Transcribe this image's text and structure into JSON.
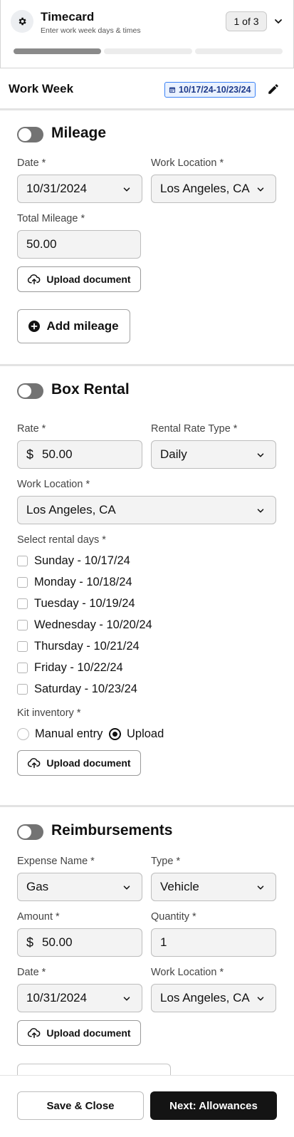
{
  "header": {
    "title": "Timecard",
    "subtitle": "Enter work week days & times",
    "pager": "1 of 3",
    "progress_steps": [
      "done",
      "pending",
      "pending"
    ]
  },
  "work_week": {
    "label": "Work Week",
    "range": "10/17/24-10/23/24"
  },
  "mileage": {
    "title": "Mileage",
    "enabled": false,
    "date_label": "Date *",
    "date_value": "10/31/2024",
    "location_label": "Work Location *",
    "location_value": "Los Angeles, CA",
    "total_label": "Total Mileage *",
    "total_value": "50.00",
    "upload_label": "Upload document",
    "add_label": "Add mileage"
  },
  "box_rental": {
    "title": "Box Rental",
    "enabled": false,
    "rate_label": "Rate *",
    "currency": "$",
    "rate_value": "50.00",
    "rate_type_label": "Rental Rate Type *",
    "rate_type_value": "Daily",
    "location_label": "Work Location *",
    "location_value": "Los Angeles, CA",
    "days_label": "Select rental days *",
    "days": [
      "Sunday - 10/17/24",
      "Monday - 10/18/24",
      "Tuesday - 10/19/24",
      "Wednesday - 10/20/24",
      "Thursday - 10/21/24",
      "Friday - 10/22/24",
      "Saturday - 10/23/24"
    ],
    "kit_label": "Kit inventory  *",
    "kit_options": [
      "Manual entry",
      "Upload"
    ],
    "kit_selected": "Upload",
    "upload_label": "Upload document"
  },
  "reimbursements": {
    "title": "Reimbursements",
    "enabled": false,
    "expense_label": "Expense Name *",
    "expense_value": "Gas",
    "type_label": "Type  *",
    "type_value": "Vehicle",
    "amount_label": "Amount *",
    "currency": "$",
    "amount_value": "50.00",
    "quantity_label": "Quantity *",
    "quantity_value": "1",
    "date_label": "Date *",
    "date_value": "10/31/2024",
    "location_label": "Work Location *",
    "location_value": "Los Angeles, CA",
    "upload_label": "Upload document"
  },
  "footer": {
    "save_label": "Save & Close",
    "next_label": "Next: Allowances"
  },
  "colors": {
    "primary": "#141414",
    "chip_border": "#3b82f6",
    "chip_bg": "#eaf2ff",
    "toggle_off": "#737373"
  }
}
